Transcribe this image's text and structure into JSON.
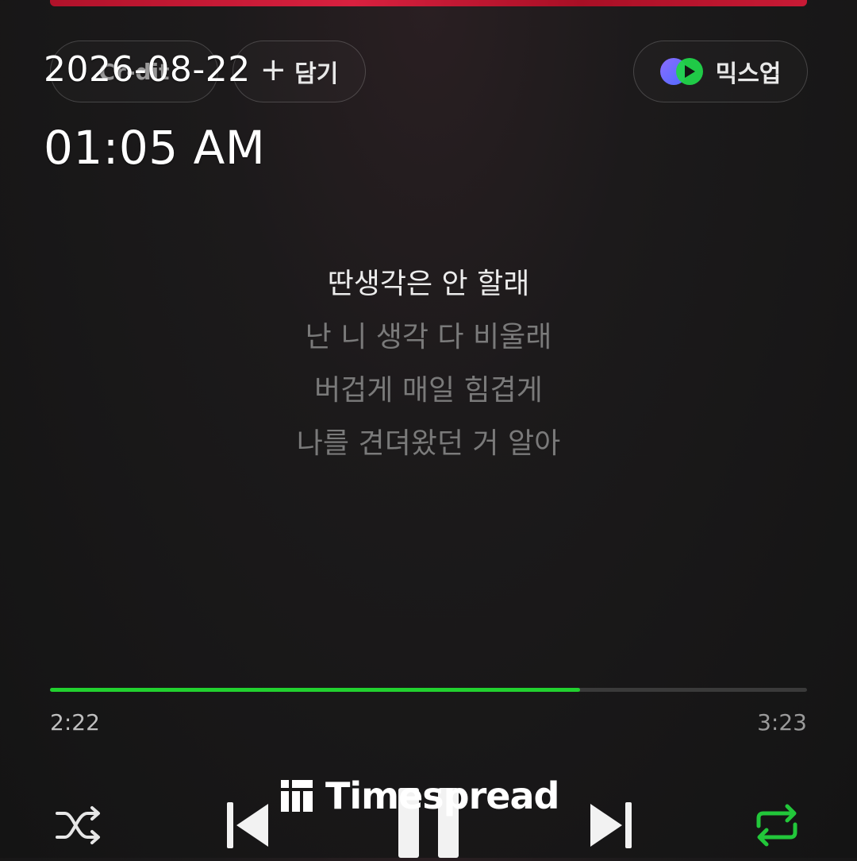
{
  "overlay": {
    "date": "2026-08-22",
    "time": "01:05 AM"
  },
  "top_buttons": {
    "credit_label": "Cr-dit",
    "add_label": "담기",
    "mix_label": "믹스업"
  },
  "lyrics": [
    "딴생각은 안 할래",
    "난 니 생각 다 비울래",
    "버겁게 매일 힘겹게",
    "나를 견뎌왔던 거 알아"
  ],
  "player": {
    "current_time": "2:22",
    "total_time": "3:23",
    "progress": 0.7,
    "accent_color": "#22d12f"
  },
  "controls": {
    "shuffle_icon": "shuffle-icon",
    "prev_icon": "skip-previous-icon",
    "play_icon": "pause-icon",
    "next_icon": "skip-next-icon",
    "repeat_icon": "repeat-icon"
  },
  "watermark": {
    "text": "Timespread"
  }
}
